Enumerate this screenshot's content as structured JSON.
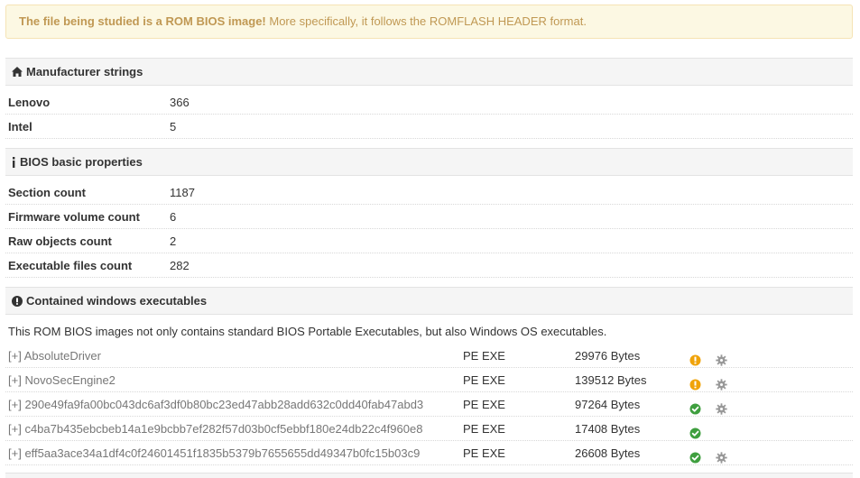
{
  "alert": {
    "strong": "The file being studied is a ROM BIOS image!",
    "rest": " More specifically, it follows the ROMFLASH HEADER format."
  },
  "manufacturer": {
    "title": "Manufacturer strings",
    "rows": [
      {
        "key": "Lenovo",
        "value": "366"
      },
      {
        "key": "Intel",
        "value": "5"
      }
    ]
  },
  "basic": {
    "title": "BIOS basic properties",
    "rows": [
      {
        "key": "Section count",
        "value": "1187"
      },
      {
        "key": "Firmware volume count",
        "value": "6"
      },
      {
        "key": "Raw objects count",
        "value": "2"
      },
      {
        "key": "Executable files count",
        "value": "282"
      }
    ]
  },
  "executables": {
    "title": "Contained windows executables",
    "description": "This ROM BIOS images not only contains standard BIOS Portable Executables, but also Windows OS executables.",
    "toggle": "[+]",
    "rows": [
      {
        "name": "AbsoluteDriver",
        "type": "PE EXE",
        "size": "29976 Bytes",
        "status": "warning",
        "gear": true
      },
      {
        "name": "NovoSecEngine2",
        "type": "PE EXE",
        "size": "139512 Bytes",
        "status": "warning",
        "gear": true
      },
      {
        "name": "290e49fa9fa00bc043dc6af3df0b80bc23ed47abb28add632c0dd40fab47abd3",
        "type": "PE EXE",
        "size": "97264 Bytes",
        "status": "ok",
        "gear": true
      },
      {
        "name": "c4ba7b435ebcbeb14a1e9bcbb7ef282f57d03b0cf5ebbf180e24db22c4f960e8",
        "type": "PE EXE",
        "size": "17408 Bytes",
        "status": "ok",
        "gear": false
      },
      {
        "name": "eff5aa3ace34a1df4c0f24601451f1835b5379b7655655dd49347b0fc15b03c9",
        "type": "PE EXE",
        "size": "26608 Bytes",
        "status": "ok",
        "gear": true
      }
    ]
  },
  "colors": {
    "warning": "#f0a30a",
    "ok": "#3f9f3f",
    "gear": "#999999"
  },
  "icons": {
    "manufacturer": "home-icon",
    "basic": "info-icon",
    "executables": "exclamation-circle-icon",
    "warning": "warning-circle-icon",
    "ok": "check-circle-icon",
    "settings": "gear-icon"
  }
}
